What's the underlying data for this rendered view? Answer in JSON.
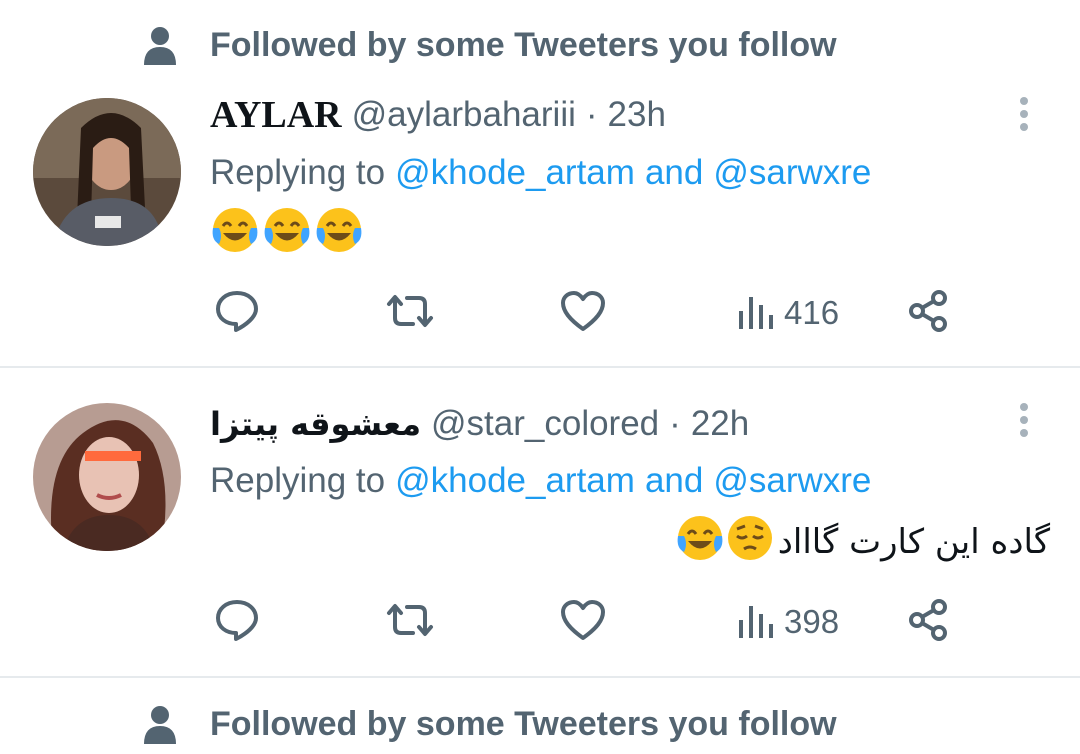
{
  "social_context": {
    "text": "Followed by some Tweeters you follow",
    "icon": "person-icon"
  },
  "tweets": [
    {
      "display_name": "AYLAR",
      "handle": "@aylarbahariii",
      "separator": "·",
      "time": "23h",
      "replying_prefix": "Replying to",
      "mention_1": "@khode_artam",
      "mention_joiner": "and",
      "mention_2": "@sarwxre",
      "text": "",
      "emojis": [
        "face-with-tears-of-joy",
        "face-with-tears-of-joy",
        "face-with-tears-of-joy"
      ],
      "views": "416"
    },
    {
      "display_name": "معشوقه پیتزا",
      "handle": "@star_colored",
      "separator": "·",
      "time": "22h",
      "replying_prefix": "Replying to",
      "mention_1": "@khode_artam",
      "mention_joiner": "and",
      "mention_2": "@sarwxre",
      "text": "گاده این کارت گاااد",
      "emojis": [
        "pensive-face",
        "face-with-tears-of-joy"
      ],
      "views": "398"
    }
  ],
  "colors": {
    "text_primary": "#0f1419",
    "text_secondary": "#536471",
    "link": "#1d9bf0",
    "divider": "#e6eaed",
    "emoji_yellow": "#fcc21b"
  }
}
